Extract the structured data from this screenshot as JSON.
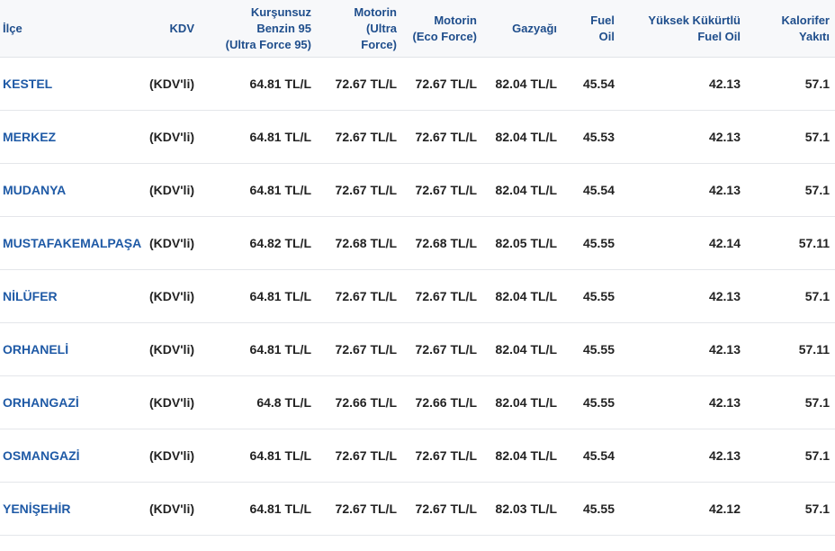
{
  "table": {
    "headers": [
      {
        "lines": [
          "İlçe"
        ]
      },
      {
        "lines": [
          "KDV"
        ]
      },
      {
        "lines": [
          "Kurşunsuz",
          "Benzin 95",
          "(Ultra Force 95)"
        ]
      },
      {
        "lines": [
          "Motorin",
          "(Ultra",
          "Force)"
        ]
      },
      {
        "lines": [
          "Motorin",
          "(Eco Force)"
        ]
      },
      {
        "lines": [
          "Gazyağı"
        ]
      },
      {
        "lines": [
          "Fuel",
          "Oil"
        ]
      },
      {
        "lines": [
          "Yüksek Kükürtlü",
          "Fuel Oil"
        ]
      },
      {
        "lines": [
          "Kalorifer",
          "Yakıtı"
        ]
      }
    ],
    "rows": [
      [
        "KESTEL",
        "(KDV'li)",
        "64.81 TL/L",
        "72.67 TL/L",
        "72.67 TL/L",
        "82.04 TL/L",
        "45.54",
        "42.13",
        "57.1"
      ],
      [
        "MERKEZ",
        "(KDV'li)",
        "64.81 TL/L",
        "72.67 TL/L",
        "72.67 TL/L",
        "82.04 TL/L",
        "45.53",
        "42.13",
        "57.1"
      ],
      [
        "MUDANYA",
        "(KDV'li)",
        "64.81 TL/L",
        "72.67 TL/L",
        "72.67 TL/L",
        "82.04 TL/L",
        "45.54",
        "42.13",
        "57.1"
      ],
      [
        "MUSTAFAKEMALPAŞA",
        "(KDV'li)",
        "64.82 TL/L",
        "72.68 TL/L",
        "72.68 TL/L",
        "82.05 TL/L",
        "45.55",
        "42.14",
        "57.11"
      ],
      [
        "NİLÜFER",
        "(KDV'li)",
        "64.81 TL/L",
        "72.67 TL/L",
        "72.67 TL/L",
        "82.04 TL/L",
        "45.55",
        "42.13",
        "57.1"
      ],
      [
        "ORHANELİ",
        "(KDV'li)",
        "64.81 TL/L",
        "72.67 TL/L",
        "72.67 TL/L",
        "82.04 TL/L",
        "45.55",
        "42.13",
        "57.11"
      ],
      [
        "ORHANGAZİ",
        "(KDV'li)",
        "64.8 TL/L",
        "72.66 TL/L",
        "72.66 TL/L",
        "82.04 TL/L",
        "45.55",
        "42.13",
        "57.1"
      ],
      [
        "OSMANGAZİ",
        "(KDV'li)",
        "64.81 TL/L",
        "72.67 TL/L",
        "72.67 TL/L",
        "82.04 TL/L",
        "45.54",
        "42.13",
        "57.1"
      ],
      [
        "YENİŞEHİR",
        "(KDV'li)",
        "64.81 TL/L",
        "72.67 TL/L",
        "72.67 TL/L",
        "82.03 TL/L",
        "45.55",
        "42.12",
        "57.1"
      ]
    ]
  }
}
